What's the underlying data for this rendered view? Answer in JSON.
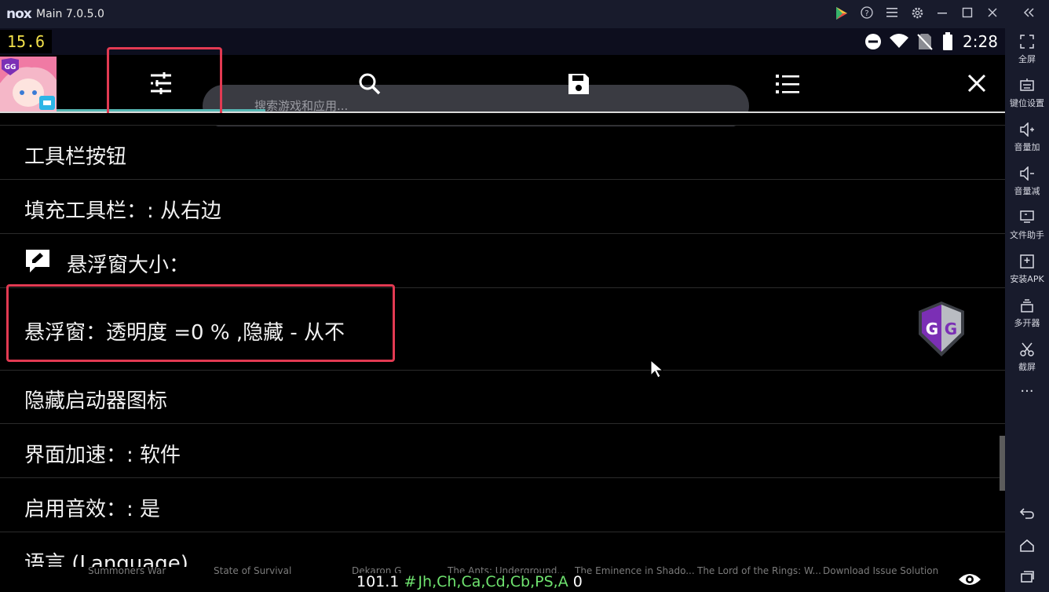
{
  "window": {
    "logo": "nox",
    "title": "Main 7.0.5.0",
    "title_icons": [
      "play-store-icon",
      "help-icon",
      "menu-icon",
      "settings-icon",
      "minimize-icon",
      "maximize-icon",
      "close-icon",
      "collapse-sidebar-icon"
    ]
  },
  "status": {
    "fps": "15.6",
    "time": "2:28",
    "icons": [
      "dnd-icon",
      "wifi-icon",
      "no-sim-icon",
      "battery-icon"
    ]
  },
  "toolbar": {
    "tabs": [
      {
        "name": "settings-tab",
        "icon": "sliders-icon",
        "selected": true
      },
      {
        "name": "search-tab",
        "icon": "search-icon"
      },
      {
        "name": "save-tab",
        "icon": "save-icon"
      },
      {
        "name": "list-tab",
        "icon": "list-icon"
      }
    ],
    "close_icon": "close-icon",
    "background_search_placeholder": "搜索游戏和应用..."
  },
  "settings": {
    "items": [
      {
        "label": "工具栏按钮"
      },
      {
        "label": "填充工具栏：: 从右边"
      },
      {
        "label": "悬浮窗大小：",
        "icon": "edit-bubble-icon"
      },
      {
        "label": "悬浮窗：透明度 =0 % ,隐藏 - 从不",
        "highlighted": true
      },
      {
        "label": "隐藏启动器图标"
      },
      {
        "label": "界面加速：: 软件"
      },
      {
        "label": "启用音效：: 是"
      },
      {
        "label": "语言 (Language)"
      }
    ]
  },
  "sidebar": {
    "items": [
      {
        "icon": "fullscreen-icon",
        "label": "全屏"
      },
      {
        "icon": "keyboard-icon",
        "label": "键位设置"
      },
      {
        "icon": "volume-up-icon",
        "label": "音量加"
      },
      {
        "icon": "volume-down-icon",
        "label": "音量减"
      },
      {
        "icon": "file-helper-icon",
        "label": "文件助手"
      },
      {
        "icon": "install-apk-icon",
        "label": "安装APK"
      },
      {
        "icon": "multi-instance-icon",
        "label": "多开器"
      },
      {
        "icon": "screenshot-icon",
        "label": "截屏"
      },
      {
        "icon": "more-icon",
        "label": "···"
      }
    ],
    "nav": [
      "back-icon",
      "home-icon",
      "recents-icon"
    ]
  },
  "bottom": {
    "readout_number": "101.1",
    "readout_hash": "#",
    "readout_codes": "Jh,Ch,Ca,Cd,Cb,PS,A",
    "readout_zero": "0",
    "background_games": [
      "Summoners War",
      "State of Survival",
      "Dekaron G",
      "The Ants: Underground...",
      "The Eminence in Shado...",
      "The Lord of the Rings: W...",
      "Download Issue Solution"
    ]
  },
  "colors": {
    "highlight": "#e23a52",
    "tab_indicator": "#57b7b4",
    "fps_text": "#f2e04a",
    "readout_codes": "#6fe36f",
    "gg_purple": "#7b2fb5"
  }
}
